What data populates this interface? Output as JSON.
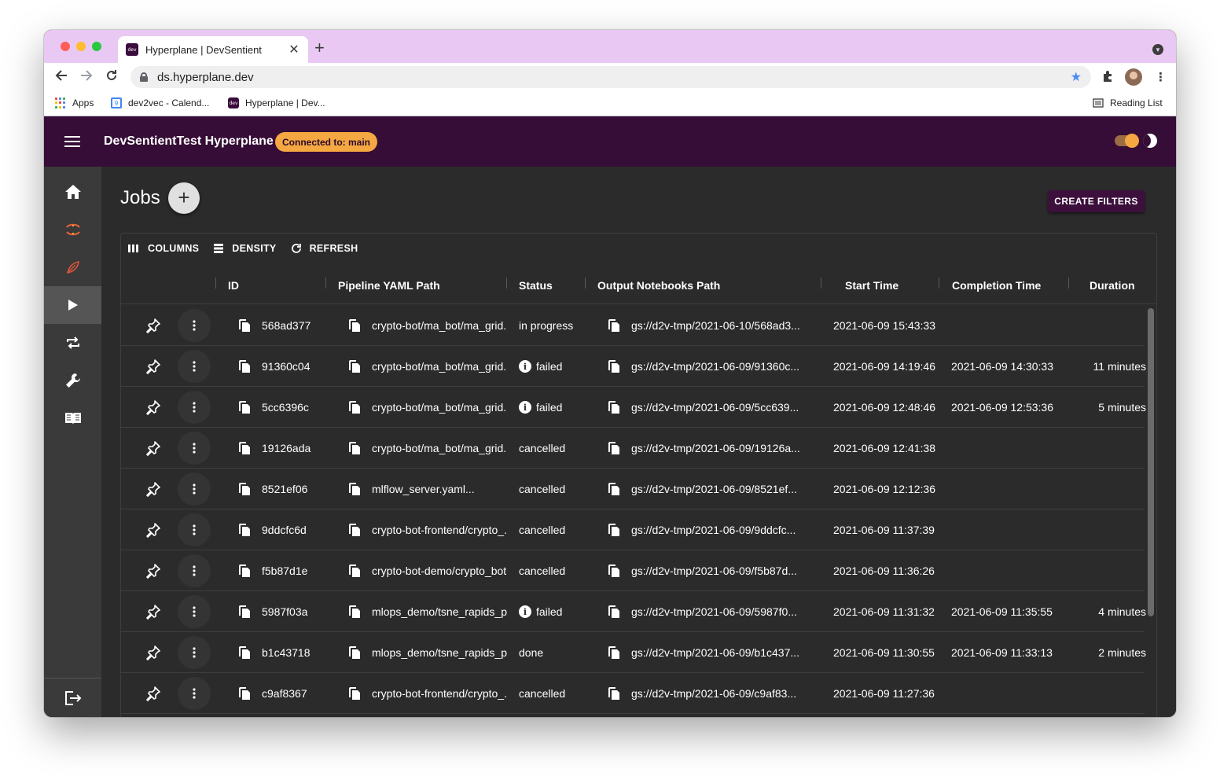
{
  "browser": {
    "tab_title": "Hyperplane | DevSentient",
    "favicon_text": "dev",
    "url": "ds.hyperplane.dev",
    "bookmarks": [
      {
        "label": "Apps",
        "icon": "apps-grid-icon"
      },
      {
        "label": "dev2vec - Calend...",
        "icon": "calendar-icon"
      },
      {
        "label": "Hyperplane | Dev...",
        "icon": "dev-favicon"
      }
    ],
    "reading_list": "Reading List"
  },
  "app": {
    "title": "DevSentientTest Hyperplane",
    "connection_chip": "Connected to: main",
    "brand_color": "#360d36",
    "accent_color": "#f5a742"
  },
  "sidebar": {
    "items": [
      {
        "icon": "home-icon",
        "active": false
      },
      {
        "icon": "sync-icon",
        "active": false
      },
      {
        "icon": "leaf-icon",
        "active": false
      },
      {
        "icon": "play-icon",
        "active": true
      },
      {
        "icon": "repeat-icon",
        "active": false
      },
      {
        "icon": "wrench-icon",
        "active": false
      },
      {
        "icon": "book-icon",
        "active": false
      }
    ],
    "logout_icon": "logout-icon"
  },
  "page": {
    "title": "Jobs",
    "add_label": "+",
    "create_filters": "CREATE FILTERS"
  },
  "grid": {
    "toolbar": {
      "columns": "COLUMNS",
      "density": "DENSITY",
      "refresh": "REFRESH"
    },
    "headers": {
      "id": "ID",
      "yaml": "Pipeline YAML Path",
      "status": "Status",
      "output": "Output Notebooks Path",
      "start": "Start Time",
      "completion": "Completion Time",
      "duration": "Duration"
    },
    "rows": [
      {
        "id": "568ad377",
        "yaml": "crypto-bot/ma_bot/ma_grid...",
        "status": "in progress",
        "status_icon": false,
        "output": "gs://d2v-tmp/2021-06-10/568ad3...",
        "start": "2021-06-09 15:43:33",
        "completion": "",
        "duration": ""
      },
      {
        "id": "91360c04",
        "yaml": "crypto-bot/ma_bot/ma_grid...",
        "status": "failed",
        "status_icon": true,
        "output": "gs://d2v-tmp/2021-06-09/91360c...",
        "start": "2021-06-09 14:19:46",
        "completion": "2021-06-09 14:30:33",
        "duration": "11 minutes"
      },
      {
        "id": "5cc6396c",
        "yaml": "crypto-bot/ma_bot/ma_grid...",
        "status": "failed",
        "status_icon": true,
        "output": "gs://d2v-tmp/2021-06-09/5cc639...",
        "start": "2021-06-09 12:48:46",
        "completion": "2021-06-09 12:53:36",
        "duration": "5 minutes"
      },
      {
        "id": "19126ada",
        "yaml": "crypto-bot/ma_bot/ma_grid...",
        "status": "cancelled",
        "status_icon": false,
        "output": "gs://d2v-tmp/2021-06-09/19126a...",
        "start": "2021-06-09 12:41:38",
        "completion": "",
        "duration": ""
      },
      {
        "id": "8521ef06",
        "yaml": "mlflow_server.yaml...",
        "status": "cancelled",
        "status_icon": false,
        "output": "gs://d2v-tmp/2021-06-09/8521ef...",
        "start": "2021-06-09 12:12:36",
        "completion": "",
        "duration": ""
      },
      {
        "id": "9ddcfc6d",
        "yaml": "crypto-bot-frontend/crypto_...",
        "status": "cancelled",
        "status_icon": false,
        "output": "gs://d2v-tmp/2021-06-09/9ddcfc...",
        "start": "2021-06-09 11:37:39",
        "completion": "",
        "duration": ""
      },
      {
        "id": "f5b87d1e",
        "yaml": "crypto-bot-demo/crypto_bot...",
        "status": "cancelled",
        "status_icon": false,
        "output": "gs://d2v-tmp/2021-06-09/f5b87d...",
        "start": "2021-06-09 11:36:26",
        "completion": "",
        "duration": ""
      },
      {
        "id": "5987f03a",
        "yaml": "mlops_demo/tsne_rapids_p...",
        "status": "failed",
        "status_icon": true,
        "output": "gs://d2v-tmp/2021-06-09/5987f0...",
        "start": "2021-06-09 11:31:32",
        "completion": "2021-06-09 11:35:55",
        "duration": "4 minutes"
      },
      {
        "id": "b1c43718",
        "yaml": "mlops_demo/tsne_rapids_p...",
        "status": "done",
        "status_icon": false,
        "output": "gs://d2v-tmp/2021-06-09/b1c437...",
        "start": "2021-06-09 11:30:55",
        "completion": "2021-06-09 11:33:13",
        "duration": "2 minutes"
      },
      {
        "id": "c9af8367",
        "yaml": "crypto-bot-frontend/crypto_...",
        "status": "cancelled",
        "status_icon": false,
        "output": "gs://d2v-tmp/2021-06-09/c9af83...",
        "start": "2021-06-09 11:27:36",
        "completion": "",
        "duration": ""
      }
    ]
  }
}
